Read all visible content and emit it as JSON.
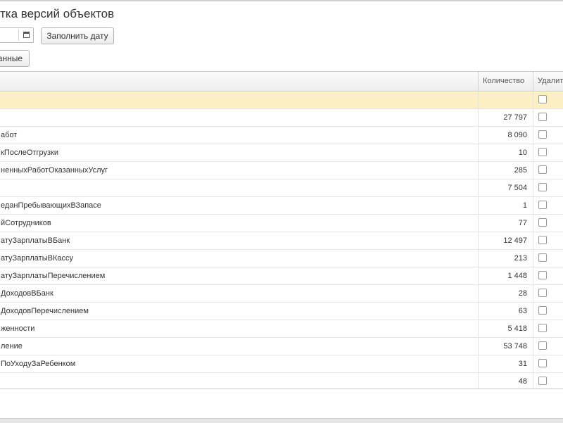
{
  "window": {
    "title": "тка версий объектов"
  },
  "toolbar": {
    "fill_date_label": "Заполнить дату",
    "data_button_label": "анные"
  },
  "table": {
    "columns": {
      "name": "",
      "quantity": "Количество",
      "delete": "Удалить"
    },
    "rows": [
      {
        "name": "",
        "quantity": ""
      },
      {
        "name": "",
        "quantity": "27 797"
      },
      {
        "name": "абот",
        "quantity": "8 090"
      },
      {
        "name": "кПослеОтгрузки",
        "quantity": "10"
      },
      {
        "name": "ненныхРаботОказанныхУслуг",
        "quantity": "285"
      },
      {
        "name": "",
        "quantity": "7 504"
      },
      {
        "name": "еданПребывающихВЗапасе",
        "quantity": "1"
      },
      {
        "name": "йСотрудников",
        "quantity": "77"
      },
      {
        "name": "атуЗарплатыВБанк",
        "quantity": "12 497"
      },
      {
        "name": "атуЗарплатыВКассу",
        "quantity": "213"
      },
      {
        "name": "атуЗарплатыПеречислением",
        "quantity": "1 448"
      },
      {
        "name": "ДоходовВБанк",
        "quantity": "28"
      },
      {
        "name": "ДоходовПеречислением",
        "quantity": "63"
      },
      {
        "name": "женности",
        "quantity": "5 418"
      },
      {
        "name": "ление",
        "quantity": "53 748"
      },
      {
        "name": "ПоУходуЗаРебенком",
        "quantity": "31"
      },
      {
        "name": "",
        "quantity": "48"
      }
    ]
  }
}
